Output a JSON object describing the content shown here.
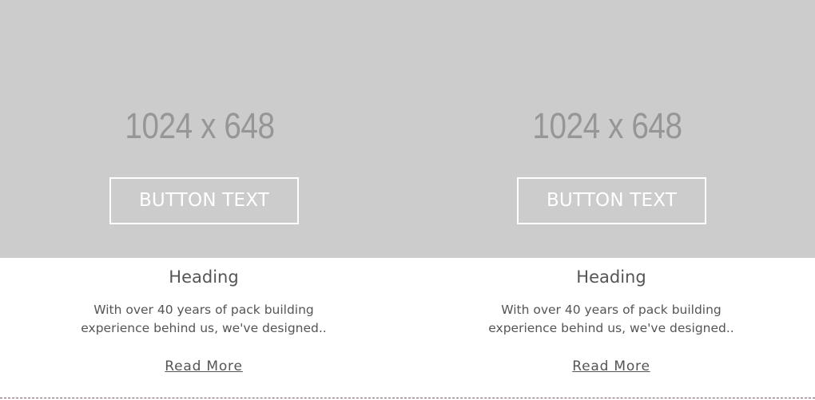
{
  "cards": [
    {
      "image_placeholder": "1024 x 648",
      "button_label": "BUTTON TEXT",
      "heading": "Heading",
      "description_line1": "With over 40 years of pack building",
      "description_line2": "experience behind us, we've designed..",
      "link_label": "Read More"
    },
    {
      "image_placeholder": "1024 x 648",
      "button_label": "BUTTON TEXT",
      "heading": "Heading",
      "description_line1": "With over 40 years of pack building",
      "description_line2": "experience behind us, we've designed..",
      "link_label": "Read More"
    }
  ],
  "colors": {
    "image_background": "#cccccc",
    "placeholder_text": "#969696",
    "body_text": "#555555",
    "divider": "#7a5a72"
  }
}
